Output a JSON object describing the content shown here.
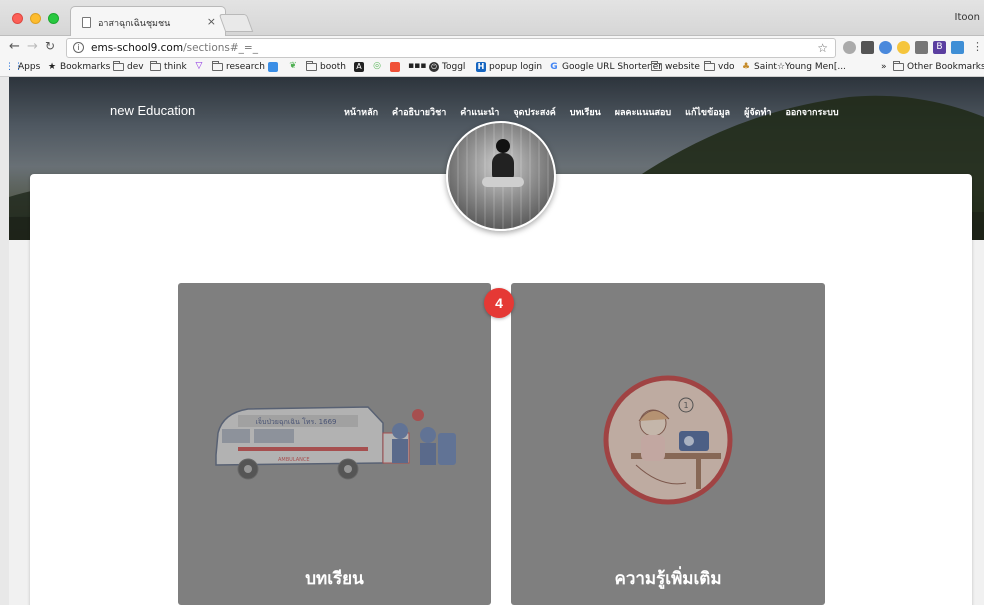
{
  "browser": {
    "tab_title": "อาสาฉุกเฉินชุมชน",
    "tab_close": "×",
    "profile_name": "Itoon",
    "url_host": "ems-school9.com",
    "url_path": "/sections#_=_",
    "info_glyph": "i",
    "star_glyph": "☆"
  },
  "bookmarks": [
    {
      "label": "Apps",
      "icon": "apps-grid-icon"
    },
    {
      "label": "Bookmarks",
      "icon": "star-icon"
    },
    {
      "label": "dev",
      "icon": "folder-icon"
    },
    {
      "label": "think",
      "icon": "folder-icon"
    },
    {
      "label": "",
      "icon": "vuejs-icon"
    },
    {
      "label": "research",
      "icon": "folder-icon"
    },
    {
      "label": "booth",
      "icon": "folder-icon"
    },
    {
      "label": "Toggl",
      "icon": "toggl-icon"
    },
    {
      "label": "popup login",
      "icon": "h-icon"
    },
    {
      "label": "Google URL Shortener",
      "icon": "google-icon"
    },
    {
      "label": "website",
      "icon": "folder-icon"
    },
    {
      "label": "vdo",
      "icon": "folder-icon"
    },
    {
      "label": "Saint☆Young Men[...",
      "icon": "manga-icon"
    },
    {
      "label": "»",
      "icon": "overflow-icon"
    },
    {
      "label": "Other Bookmarks",
      "icon": "folder-icon"
    }
  ],
  "site": {
    "brand": "new Education",
    "nav": [
      "หน้าหลัก",
      "คำอธิบายวิชา",
      "คำแนะนำ",
      "จุดประสงค์",
      "บทเรียน",
      "ผลคะแนนสอบ",
      "แก้ไขข้อมูล",
      "ผู้จัดทำ",
      "ออกจากระบบ"
    ],
    "badge_count": "4",
    "tiles": [
      {
        "label": "บทเรียน",
        "image": "ambulance-illustration"
      },
      {
        "label": "ความรู้เพิ่มเติม",
        "image": "sick-girl-illustration"
      }
    ],
    "ambulance_text": "เจ็บป่วยฉุกเฉิน โทร. 1669",
    "ambulance_sub": "AMBULANCE"
  },
  "colors": {
    "tile_bg": "#7f7f7f",
    "badge": "#e53935",
    "page_bg": "#f1f1f1"
  }
}
